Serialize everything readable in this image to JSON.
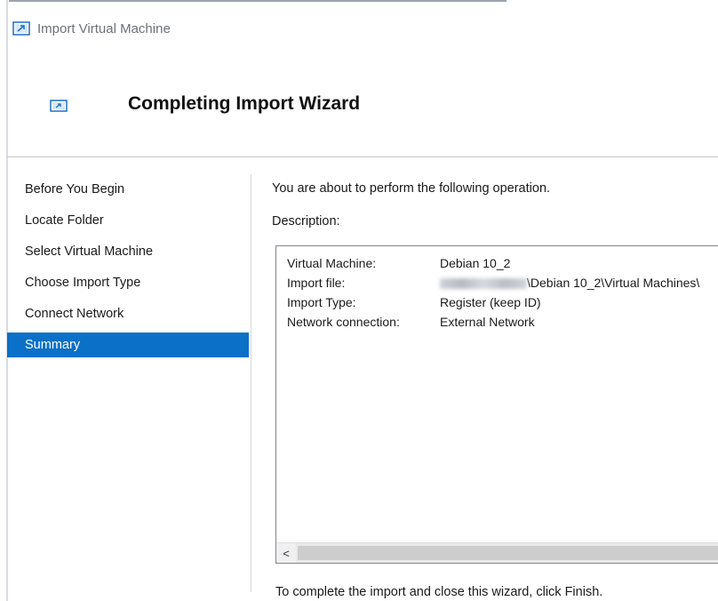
{
  "window": {
    "title": "Import Virtual Machine",
    "header_title": "Completing Import Wizard"
  },
  "sidebar": {
    "items": [
      {
        "label": "Before You Begin",
        "active": false
      },
      {
        "label": "Locate Folder",
        "active": false
      },
      {
        "label": "Select Virtual Machine",
        "active": false
      },
      {
        "label": "Choose Import Type",
        "active": false
      },
      {
        "label": "Connect Network",
        "active": false
      },
      {
        "label": "Summary",
        "active": true
      }
    ]
  },
  "main": {
    "intro": "You are about to perform the following operation.",
    "description_label": "Description:",
    "rows": [
      {
        "key": "Virtual Machine:",
        "value": "Debian 10_2"
      },
      {
        "key": "Import file:",
        "value": "\\Debian 10_2\\Virtual Machines\\"
      },
      {
        "key": "Import Type:",
        "value": "Register (keep ID)"
      },
      {
        "key": "Network connection:",
        "value": "External Network"
      }
    ],
    "scroll_left_glyph": "<",
    "footer": "To complete the import and close this wizard, click Finish."
  },
  "colors": {
    "selection": "#0a70c8",
    "icon_blue": "#1f6fc5"
  },
  "icons": [
    "import-vm-icon",
    "wizard-header-icon",
    "scroll-left-arrow-icon"
  ]
}
